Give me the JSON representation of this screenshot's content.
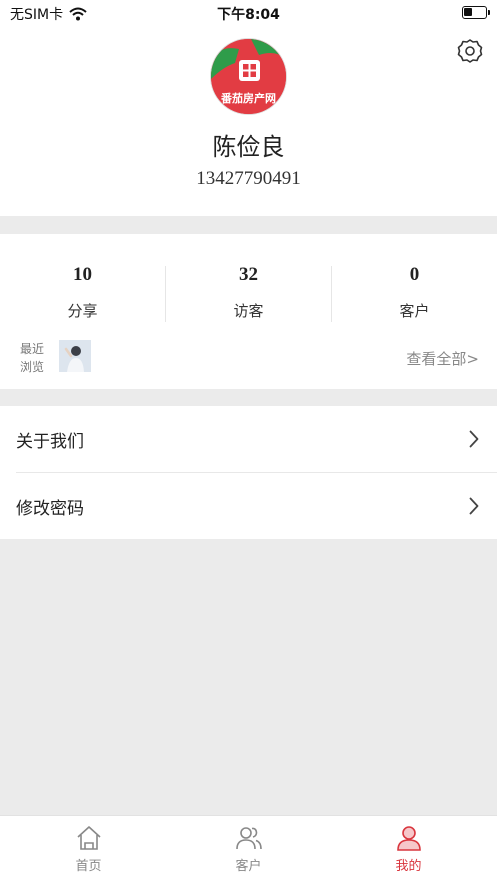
{
  "status_bar": {
    "carrier": "无SIM卡",
    "time": "下午8:04"
  },
  "profile": {
    "avatar_text": "番茄房产网",
    "name": "陈俭良",
    "phone": "13427790491"
  },
  "stats": [
    {
      "value": "10",
      "label": "分享"
    },
    {
      "value": "32",
      "label": "访客"
    },
    {
      "value": "0",
      "label": "客户"
    }
  ],
  "recent": {
    "label_line1": "最近",
    "label_line2": "浏览",
    "view_all": "查看全部>"
  },
  "menu": [
    {
      "label": "关于我们"
    },
    {
      "label": "修改密码"
    }
  ],
  "tabs": [
    {
      "label": "首页",
      "icon": "home-icon"
    },
    {
      "label": "客户",
      "icon": "users-icon"
    },
    {
      "label": "我的",
      "icon": "profile-icon",
      "active": true
    }
  ],
  "colors": {
    "accent": "#d9363e",
    "background": "#ebebeb"
  }
}
